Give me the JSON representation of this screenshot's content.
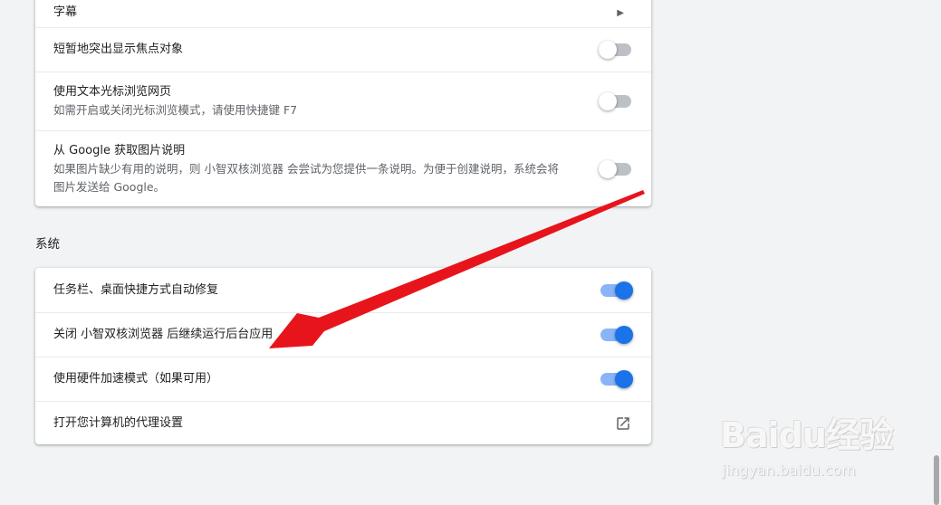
{
  "accessibility": {
    "items": [
      {
        "label": "字幕",
        "control": "chevron"
      },
      {
        "label": "短暂地突出显示焦点对象",
        "control": "toggle",
        "enabled": false
      },
      {
        "label": "使用文本光标浏览网页",
        "sub": "如需开启或关闭光标浏览模式，请使用快捷键 F7",
        "control": "toggle",
        "enabled": false
      },
      {
        "label": "从 Google 获取图片说明",
        "sub1": "如果图片缺少有用的说明，则 小智双核浏览器 会尝试为您提供一条说明。为便于创建说明，系统会将",
        "sub2": "图片发送给 Google。",
        "control": "toggle",
        "enabled": false
      }
    ]
  },
  "system": {
    "title": "系统",
    "items": [
      {
        "label": "任务栏、桌面快捷方式自动修复",
        "control": "toggle",
        "enabled": true
      },
      {
        "label": "关闭 小智双核浏览器 后继续运行后台应用",
        "control": "toggle",
        "enabled": true
      },
      {
        "label": "使用硬件加速模式（如果可用）",
        "control": "toggle",
        "enabled": true
      },
      {
        "label": "打开您计算机的代理设置",
        "control": "external-link-icon"
      }
    ]
  },
  "watermark": {
    "logo": "Baidu经验",
    "url": "jingyan.baidu.com"
  },
  "colors": {
    "accent": "#1a73e8",
    "annotation": "#e8141b",
    "background": "#f1f3f4"
  }
}
